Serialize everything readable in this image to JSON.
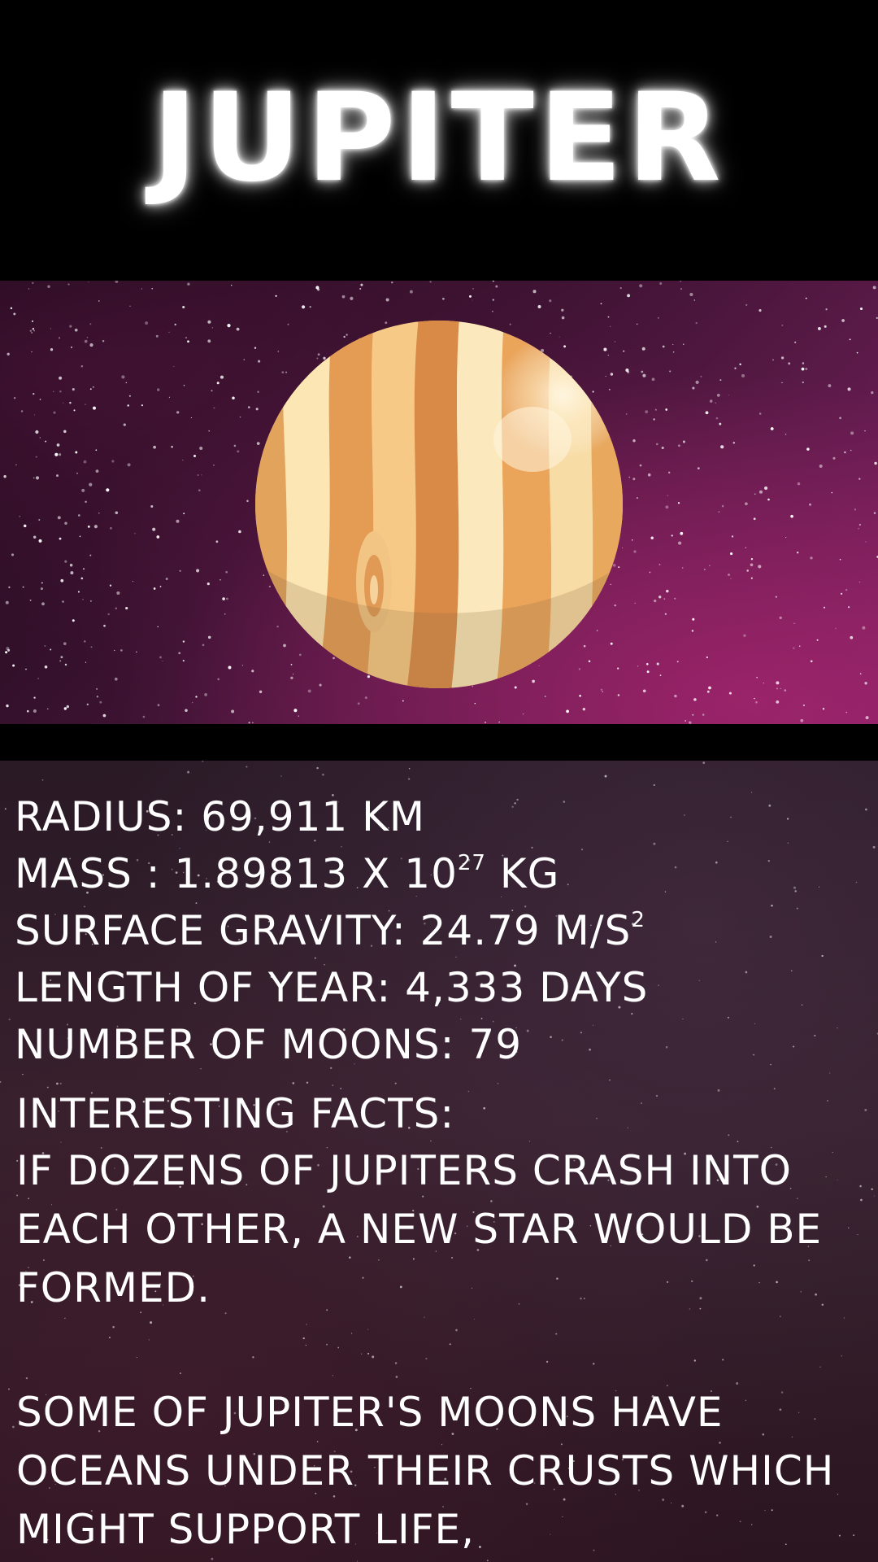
{
  "title": "JUPITER",
  "stats": {
    "radius": "RADIUS: 69,911 KM",
    "mass_prefix": "MASS  : 1.89813 X 10",
    "mass_exp": "27",
    "mass_suffix": " KG",
    "gravity_prefix": "SURFACE GRAVITY: 24.79 M/S",
    "gravity_exp": "2",
    "year": "LENGTH OF YEAR: 4,333 DAYS",
    "moons": "NUMBER OF MOONS: 79"
  },
  "facts": {
    "heading": "INTERESTING FACTS:",
    "items": [
      "IF DOZENS OF JUPITERS CRASH INTO EACH OTHER, A NEW STAR WOULD BE FORMED.",
      "SOME OF JUPITER'S MOONS HAVE OCEANS UNDER THEIR CRUSTS WHICH MIGHT SUPPORT LIFE,"
    ]
  },
  "icons": {
    "planet": "jupiter-illustration",
    "background": "starfield"
  },
  "colors": {
    "text": "#ffffff",
    "header_bg": "#000000",
    "space_purple": "#5a1a48",
    "planet_light": "#fbecc0",
    "planet_orange": "#e9a55a",
    "planet_dark": "#c8843c"
  }
}
